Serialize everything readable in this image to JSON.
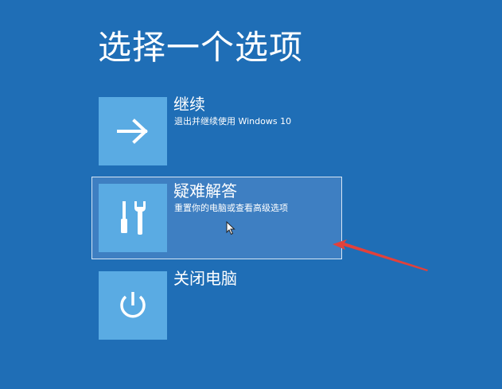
{
  "screen": {
    "title": "选择一个选项",
    "background_color": "#1f6eb6",
    "tile_color": "#5aabe3",
    "highlight_color": "#3e7fc2",
    "annotation_color": "#e2413b"
  },
  "options": [
    {
      "id": "continue",
      "label": "继续",
      "description": "退出并继续使用 Windows 10",
      "icon": "arrow-right-icon",
      "selected": false
    },
    {
      "id": "troubleshoot",
      "label": "疑难解答",
      "description": "重置你的电脑或查看高级选项",
      "icon": "tools-icon",
      "selected": true
    },
    {
      "id": "shutdown",
      "label": "关闭电脑",
      "description": "",
      "icon": "power-icon",
      "selected": false
    }
  ]
}
